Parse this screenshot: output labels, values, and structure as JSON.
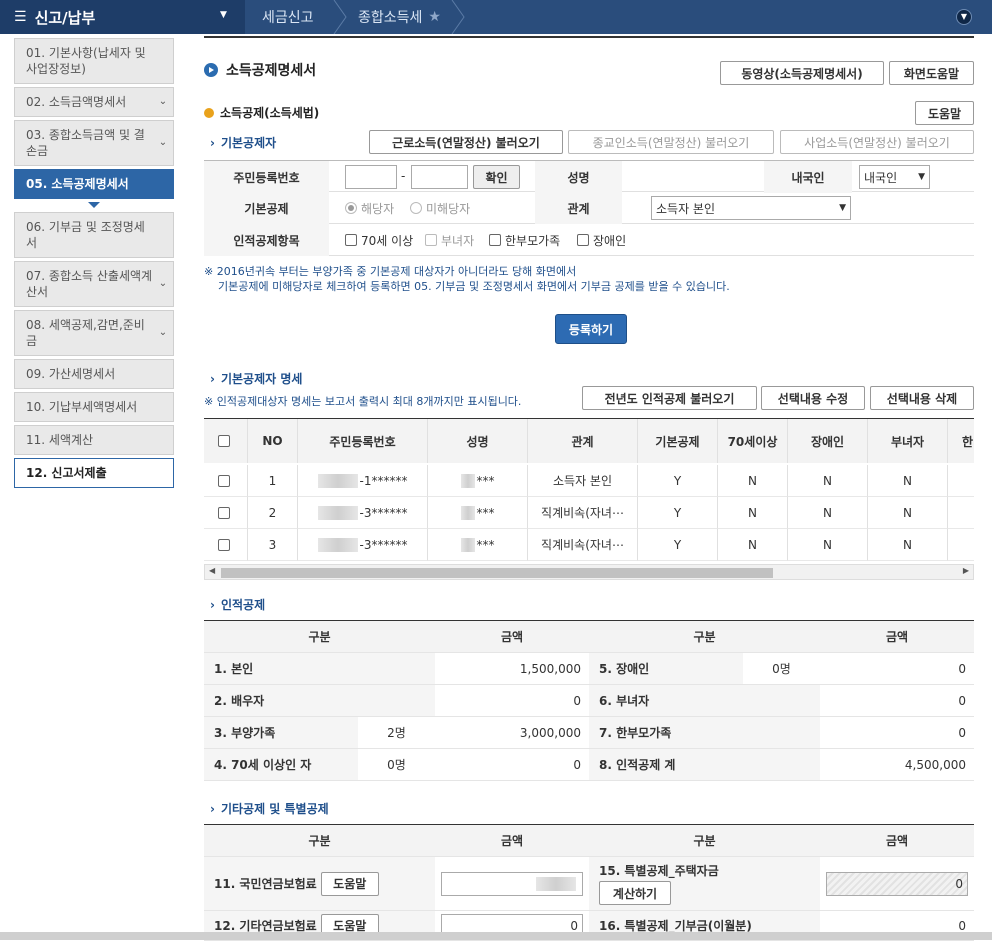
{
  "topbar": {
    "menu_icon": "hamburger-icon",
    "menu_title": "신고/납부",
    "crumbs": [
      "세금신고",
      "종합소득세"
    ]
  },
  "sidebar": {
    "items": [
      {
        "label": "01. 기본사항(납세자 및 사업장정보)",
        "state": "normal",
        "chevron": false
      },
      {
        "label": "02. 소득금액명세서",
        "state": "normal",
        "chevron": true
      },
      {
        "label": "03. 종합소득금액 및 결손금",
        "state": "normal",
        "chevron": true
      },
      {
        "label": "05. 소득공제명세서",
        "state": "active",
        "chevron": false
      },
      {
        "label": "06. 기부금 및 조정명세서",
        "state": "normal",
        "chevron": false
      },
      {
        "label": "07. 종합소득 산출세액계산서",
        "state": "normal",
        "chevron": true
      },
      {
        "label": "08. 세액공제,감면,준비금",
        "state": "normal",
        "chevron": true
      },
      {
        "label": "09. 가산세명세서",
        "state": "normal",
        "chevron": false
      },
      {
        "label": "10. 기납부세액명세서",
        "state": "normal",
        "chevron": false
      },
      {
        "label": "11. 세액계산",
        "state": "normal",
        "chevron": false
      },
      {
        "label": "12. 신고서제출",
        "state": "last",
        "chevron": false
      }
    ]
  },
  "page": {
    "title": "소득공제명세서",
    "video_button": "동영상(소득공제명세서)",
    "help_button": "화면도움말",
    "subtitle": "소득공제(소득세법)",
    "help2": "도움말"
  },
  "basic": {
    "section": "기본공제자",
    "load_buttons": [
      "근로소득(연말정산) 불러오기",
      "종교인소득(연말정산) 불러오기",
      "사업소득(연말정산) 불러오기"
    ],
    "labels": {
      "rrn": "주민등록번호",
      "confirm": "확인",
      "name": "성명",
      "native": "내국인",
      "basic": "기본공제",
      "relation": "관계",
      "personal": "인적공제항목"
    },
    "rrn_dash": "-",
    "native_value": "내국인",
    "radio_yes": "해당자",
    "radio_no": "미해당자",
    "relation_value": "소득자 본인",
    "personal_opts": [
      "70세 이상",
      "부녀자",
      "한부모가족",
      "장애인"
    ],
    "note_lines": [
      "※ 2016년귀속 부터는 부양가족 중 기본공제 대상자가 아니더라도 당해 화면에서",
      "기본공제에 미해당자로 체크하여 등록하면 05. 기부금 및 조정명세서 화면에서 기부금 공제를 받을 수 있습니다."
    ],
    "register_button": "등록하기"
  },
  "detail": {
    "section": "기본공제자 명세",
    "note": "※ 인적공제대상자 명세는 보고서 출력시 최대 8개까지만 표시됩니다.",
    "buttons": [
      "전년도 인적공제 불러오기",
      "선택내용 수정",
      "선택내용 삭제"
    ],
    "headers": [
      "NO",
      "주민등록번호",
      "성명",
      "관계",
      "기본공제",
      "70세이상",
      "장애인",
      "부녀자",
      "한"
    ],
    "rows": [
      {
        "no": "1",
        "rrn": "-1******",
        "name": "***",
        "relation": "소득자 본인",
        "basic": "Y",
        "old": "N",
        "dis": "N",
        "woman": "N"
      },
      {
        "no": "2",
        "rrn": "-3******",
        "name": "***",
        "relation": "직계비속(자녀⋯",
        "basic": "Y",
        "old": "N",
        "dis": "N",
        "woman": "N"
      },
      {
        "no": "3",
        "rrn": "-3******",
        "name": "***",
        "relation": "직계비속(자녀⋯",
        "basic": "Y",
        "old": "N",
        "dis": "N",
        "woman": "N"
      }
    ]
  },
  "personal": {
    "section": "인적공제",
    "headers": [
      "구분",
      "금액",
      "구분",
      "금액"
    ],
    "left": [
      {
        "label": "1. 본인",
        "count": "",
        "amount": "1,500,000"
      },
      {
        "label": "2. 배우자",
        "count": "",
        "amount": "0"
      },
      {
        "label": "3. 부양가족",
        "count": "2명",
        "amount": "3,000,000"
      },
      {
        "label": "4. 70세 이상인 자",
        "count": "0명",
        "amount": "0"
      }
    ],
    "right": [
      {
        "label": "5. 장애인",
        "count": "0명",
        "amount": "0"
      },
      {
        "label": "6. 부녀자",
        "count": "",
        "amount": "0"
      },
      {
        "label": "7. 한부모가족",
        "count": "",
        "amount": "0"
      },
      {
        "label": "8. 인적공제 계",
        "count": "",
        "amount": "4,500,000"
      }
    ]
  },
  "other": {
    "section": "기타공제 및 특별공제",
    "headers": [
      "구분",
      "금액",
      "구분",
      "금액"
    ],
    "row1_left": "11. 국민연금보험료",
    "row1_help": "도움말",
    "row1_right": "15. 특별공제_주택자금",
    "row1_calc": "계산하기",
    "row1_right_value": "0",
    "row2_left": "12. 기타연금보험료",
    "row2_help": "도움말",
    "row2_value": "0",
    "row2_right": "16. 특별공제_기부금(이월분)",
    "row2_right_value": "0"
  }
}
